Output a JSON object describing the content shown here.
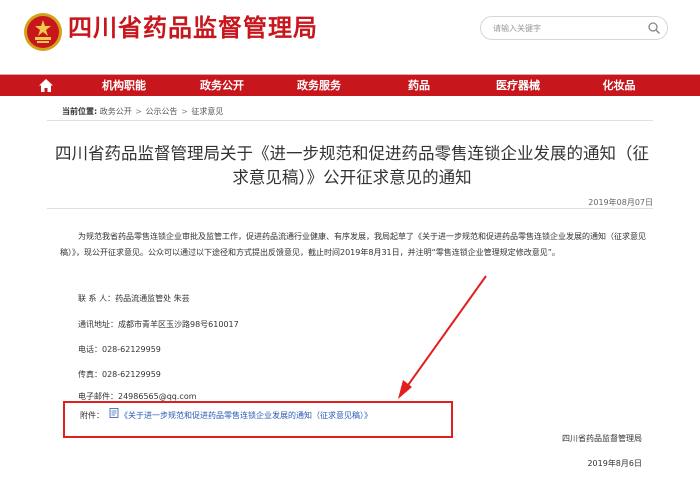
{
  "header": {
    "site_title": "四川省药品监督管理局",
    "search_placeholder": "请输入关键字"
  },
  "nav": {
    "home_icon": "home-icon",
    "items": [
      "机构职能",
      "政务公开",
      "政务服务",
      "药品",
      "医疗器械",
      "化妆品"
    ]
  },
  "breadcrumb": {
    "label": "当前位置:",
    "items": [
      "政务公开",
      "公示公告",
      "征求意见"
    ],
    "separator": ">"
  },
  "article": {
    "title": "四川省药品监督管理局关于《进一步规范和促进药品零售连锁企业发展的通知（征求意见稿）》公开征求意见的通知",
    "date": "2019年08月07日",
    "intro": "为规范我省药品零售连锁企业审批及监管工作，促进药品流通行业健康、有序发展，我局起草了《关于进一步规范和促进药品零售连锁企业发展的通知（征求意见稿）》，现公开征求意见。公众可以通过以下途径和方式提出反馈意见，截止时间2019年8月31日，并注明“零售连锁企业管理规定修改意见”。",
    "contact": "联 系 人：药品流通监管处 朱芸",
    "address": "通讯地址：成都市青羊区玉沙路98号610017",
    "phone": "电话：028-62129959",
    "fax": "传真：028-62129959",
    "email": "电子邮件：24986565@qq.com",
    "attachment_label": "附件：",
    "attachment_link": "《关于进一步规范和促进药品零售连锁企业发展的通知（征求意见稿）》",
    "signature": "四川省药品监督管理局",
    "sign_date": "2019年8月6日"
  },
  "colors": {
    "brand_red": "#c8161d",
    "link_blue": "#2a5bb5",
    "annotation_red": "#e02020"
  }
}
